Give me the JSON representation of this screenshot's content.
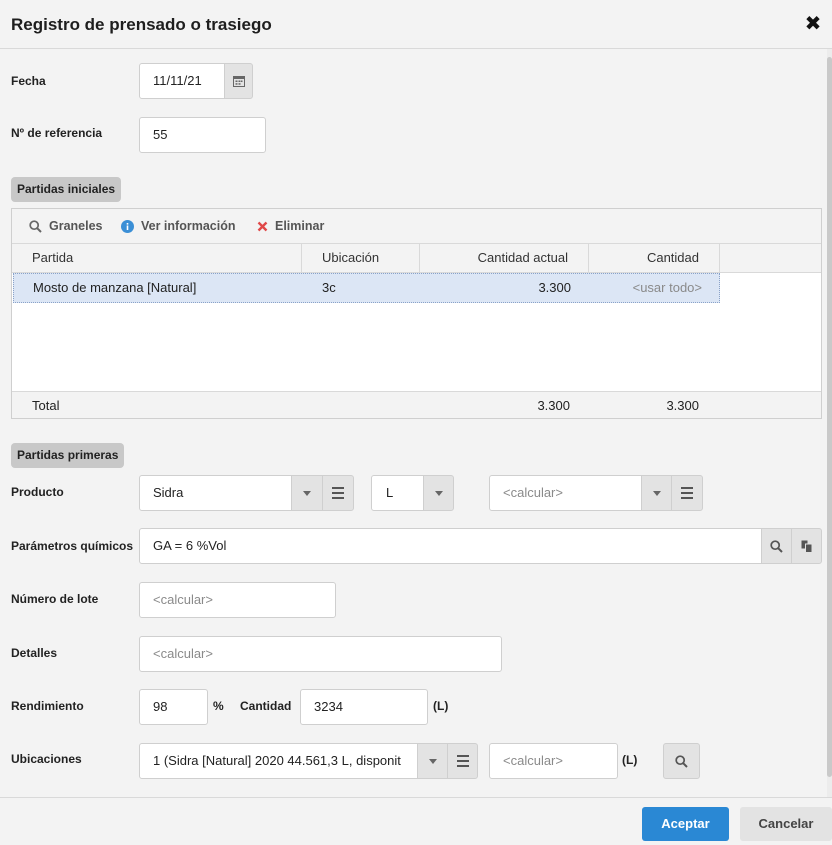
{
  "dialog": {
    "title": "Registro de prensado o trasiego",
    "close_symbol": "✖"
  },
  "fecha": {
    "label": "Fecha",
    "value": "11/11/21"
  },
  "referencia": {
    "label": "Nº de referencia",
    "value": "55"
  },
  "partidas_iniciales": {
    "section_label": "Partidas iniciales",
    "toolbar": {
      "graneles": "Graneles",
      "ver_info": "Ver información",
      "eliminar": "Eliminar"
    },
    "columns": [
      "Partida",
      "Ubicación",
      "Cantidad actual",
      "Cantidad"
    ],
    "rows": [
      {
        "partida": "Mosto de manzana [Natural]",
        "ubicacion": "3c",
        "cantidad_actual": "3.300",
        "cantidad": "<usar todo>"
      }
    ],
    "footer": {
      "label": "Total",
      "cantidad_actual": "3.300",
      "cantidad": "3.300"
    }
  },
  "partidas_primeras": {
    "section_label": "Partidas primeras",
    "producto": {
      "label": "Producto",
      "value": "Sidra",
      "unit": "L",
      "extra_placeholder": "<calcular>"
    },
    "parametros": {
      "label": "Parámetros químicos",
      "value": "GA = 6 %Vol"
    },
    "lote": {
      "label": "Número de lote",
      "placeholder": "<calcular>"
    },
    "detalles": {
      "label": "Detalles",
      "placeholder": "<calcular>"
    },
    "rendimiento": {
      "label": "Rendimiento",
      "value": "98",
      "unit": "%"
    },
    "cantidad": {
      "label": "Cantidad",
      "value": "3234",
      "unit": "(L)"
    },
    "ubicaciones": {
      "label": "Ubicaciones",
      "value": "1 (Sidra [Natural] 2020 44.561,3 L, disponit",
      "qty_placeholder": "<calcular>",
      "unit": "(L)"
    }
  },
  "actions": {
    "accept": "Aceptar",
    "cancel": "Cancelar"
  },
  "colors": {
    "primary": "#2a88d4",
    "selected_row": "#dce6f5",
    "danger": "#e04848",
    "info": "#3b8fd6"
  }
}
